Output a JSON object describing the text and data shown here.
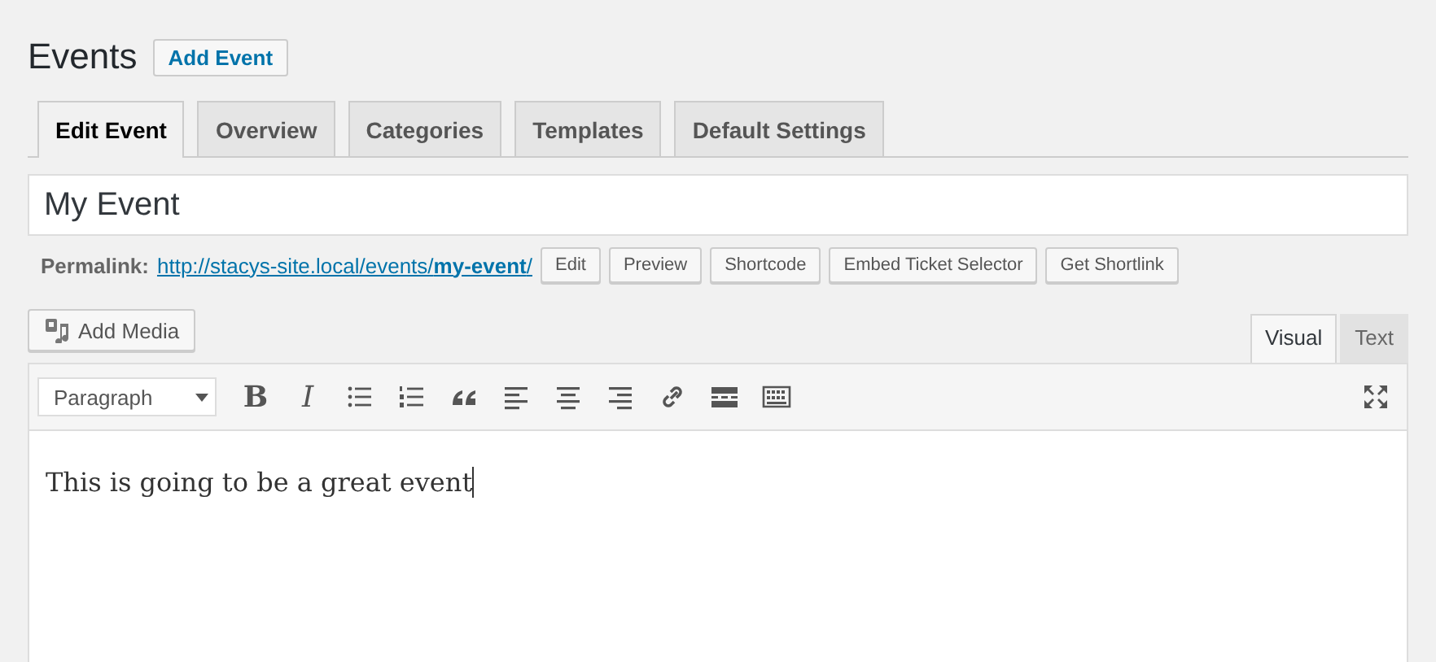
{
  "page": {
    "title": "Events",
    "add_button": "Add Event"
  },
  "tabs": [
    {
      "label": "Edit Event",
      "selected": true
    },
    {
      "label": "Overview",
      "selected": false
    },
    {
      "label": "Categories",
      "selected": false
    },
    {
      "label": "Templates",
      "selected": false
    },
    {
      "label": "Default Settings",
      "selected": false
    }
  ],
  "title_field": {
    "value": "My Event"
  },
  "permalink": {
    "label": "Permalink:",
    "url": "http://stacys-site.local/events/**my-event**/",
    "buttons": [
      "Edit",
      "Preview",
      "Shortcode",
      "Embed Ticket Selector",
      "Get Shortlink"
    ]
  },
  "editor": {
    "add_media": "Add Media",
    "mode_tabs": [
      {
        "label": "Visual",
        "selected": true
      },
      {
        "label": "Text",
        "selected": false
      }
    ],
    "format_select": "Paragraph",
    "toolbar": [
      {
        "kind": "bold",
        "label": "B"
      },
      {
        "kind": "italic",
        "label": "I"
      },
      {
        "kind": "bullets"
      },
      {
        "kind": "numbers"
      },
      {
        "kind": "quote"
      },
      {
        "kind": "align-left"
      },
      {
        "kind": "align-center"
      },
      {
        "kind": "align-right"
      },
      {
        "kind": "link"
      },
      {
        "kind": "more"
      },
      {
        "kind": "toolbar-toggle"
      }
    ],
    "content": "This is going to be a great event"
  }
}
